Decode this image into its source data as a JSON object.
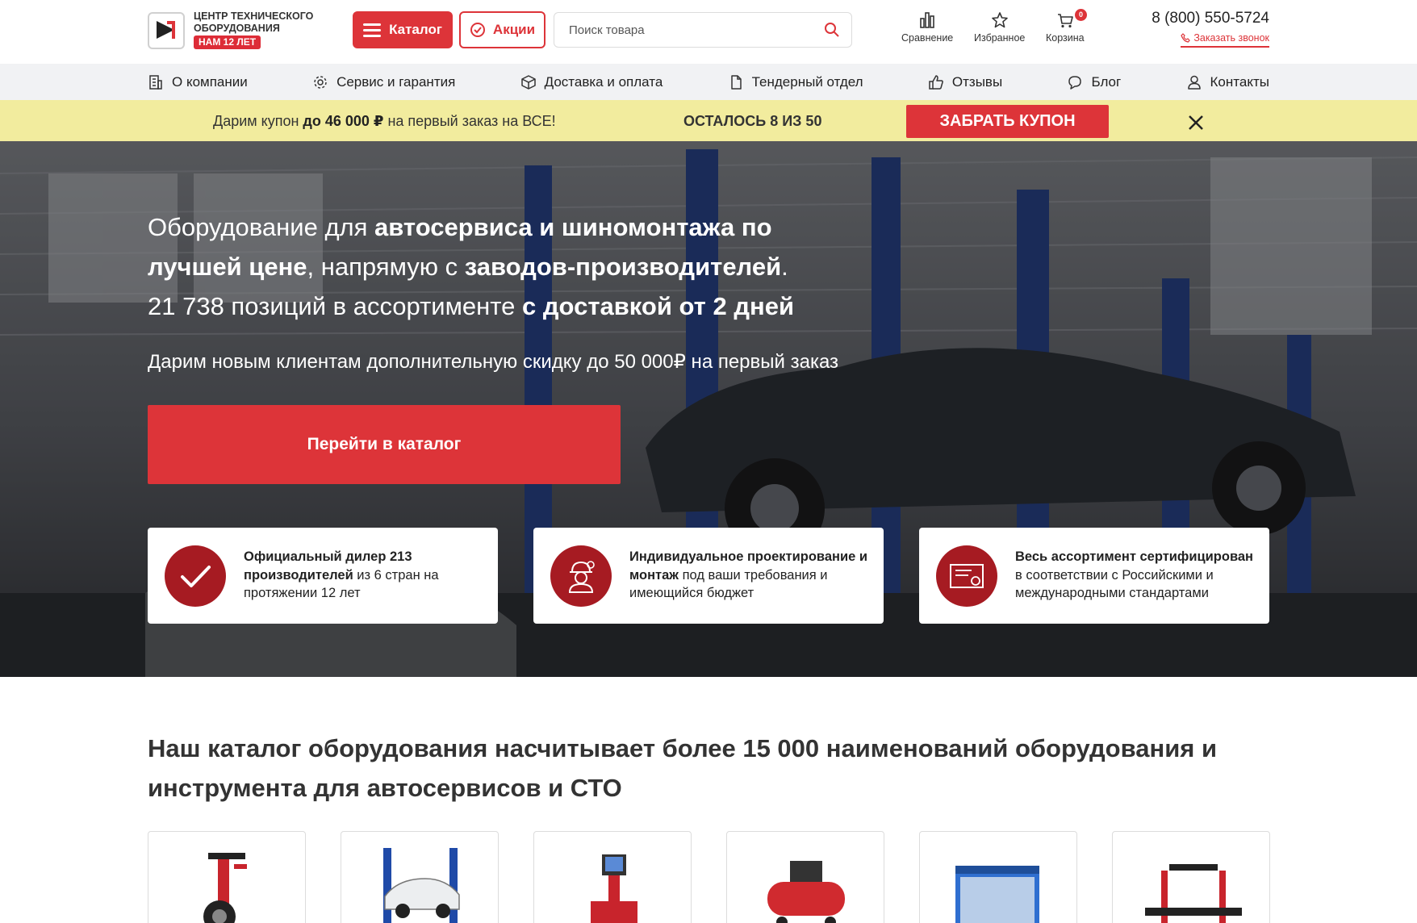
{
  "header": {
    "logo_text_line1": "Центр технического",
    "logo_text_line2": "оборудования",
    "logo_badge": "НАМ 12 ЛЕТ",
    "logo_mark": "ЦТО",
    "catalog_label": "Каталог",
    "promo_label": "Акции",
    "search_placeholder": "Поиск товара",
    "compare_label": "Сравнение",
    "favorites_label": "Избранное",
    "cart_label": "Корзина",
    "cart_count": "0",
    "phone": "8 (800) 550-5724",
    "callback_label": "Заказать звонок"
  },
  "nav": {
    "items": [
      {
        "label": "О компании",
        "icon": "building-icon"
      },
      {
        "label": "Сервис и гарантия",
        "icon": "gear-icon"
      },
      {
        "label": "Доставка и оплата",
        "icon": "box-icon"
      },
      {
        "label": "Тендерный отдел",
        "icon": "document-icon"
      },
      {
        "label": "Отзывы",
        "icon": "thumbs-up-icon"
      },
      {
        "label": "Блог",
        "icon": "chat-icon"
      },
      {
        "label": "Контакты",
        "icon": "user-icon"
      }
    ]
  },
  "promo_bar": {
    "text_before": "Дарим купон ",
    "text_bold": "до 46 000 ₽",
    "text_after": " на первый заказ на ВСЕ!",
    "remaining": "ОСТАЛОСЬ 8 ИЗ 50",
    "button_label": "ЗАБРАТЬ КУПОН"
  },
  "hero": {
    "line1_normal": "Оборудование для ",
    "line1_bold": "автосервиса и шиномонтажа по",
    "line2_bold": "лучшей цене",
    "line2_normal": ", напрямую с ",
    "line2_bold2": "заводов-производителей",
    "line2_end": ".",
    "line3_normal": "21 738 позиций в ассортименте ",
    "line3_bold": "с доставкой от 2 дней",
    "subtitle": "Дарим новым клиентам дополнительную скидку до 50 000₽ на первый заказ",
    "button_label": "Перейти в каталог"
  },
  "features": [
    {
      "bold": "Официальный дилер 213 производителей",
      "normal": " из 6 стран на протяжении 12 лет",
      "icon": "checkmark-icon"
    },
    {
      "bold": "Индивидуальное проектирование и монтаж",
      "normal": " под ваши требования и имеющийся бюджет",
      "icon": "engineer-icon"
    },
    {
      "bold": "Весь ассортимент сертифицирован",
      "normal": " в соответствии с Российскими и международными стандартами",
      "icon": "certificate-icon"
    }
  ],
  "catalog": {
    "title": "Наш каталог оборудования насчитывает более 15 000 наименований оборудования и инструмента для автосервисов и СТО",
    "cards": [
      {
        "icon": "tire-changer-icon"
      },
      {
        "icon": "car-lift-icon"
      },
      {
        "icon": "wheel-alignment-icon"
      },
      {
        "icon": "compressor-icon"
      },
      {
        "icon": "paint-booth-icon"
      },
      {
        "icon": "body-straightening-icon"
      }
    ]
  },
  "colors": {
    "accent": "#dd3439",
    "accent_dark": "#a61b22",
    "promo_bg": "#f2ec9e",
    "nav_bg": "#f1f2f4"
  }
}
